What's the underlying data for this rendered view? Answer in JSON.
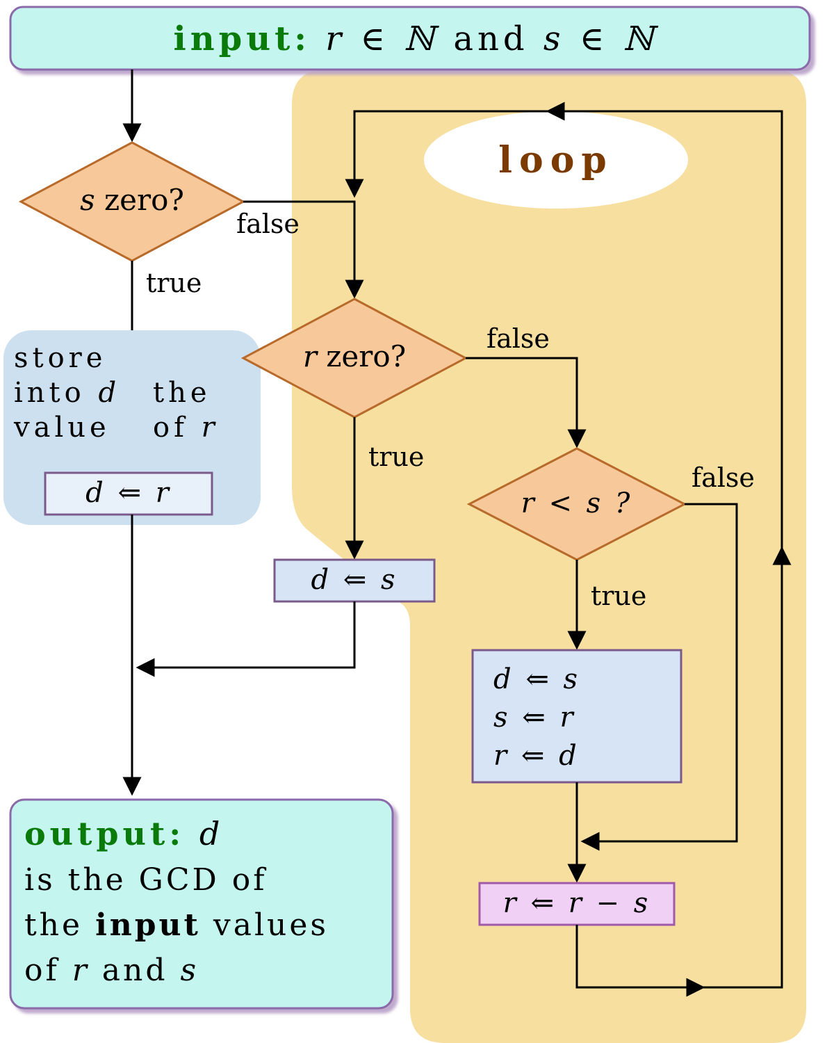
{
  "input": {
    "label": "input:",
    "expr_r": "r ∈ ℕ",
    "and": "and",
    "expr_s": "s ∈ ℕ"
  },
  "decisions": {
    "s_zero": "s zero?",
    "r_zero": "r zero?",
    "r_lt_s": "r < s ?"
  },
  "edge_labels": {
    "true": "true",
    "false": "false"
  },
  "store_block": {
    "line1a": "store",
    "line2a": "into d",
    "line2b": "the",
    "line3a": "value",
    "line3b": "of r",
    "assign": "d ⇐ r"
  },
  "assign_d_s": "d ⇐ s",
  "swap_block": {
    "l1": "d ⇐ s",
    "l2": "s ⇐ r",
    "l3": "r ⇐ d"
  },
  "update_r": "r ⇐ r − s",
  "loop_label": "loop",
  "output": {
    "label": "output:",
    "line1_var": "d",
    "line2": "is the GCD of",
    "line3a": "the",
    "line3b": "input",
    "line3c": "values",
    "line4": "of r and s"
  }
}
